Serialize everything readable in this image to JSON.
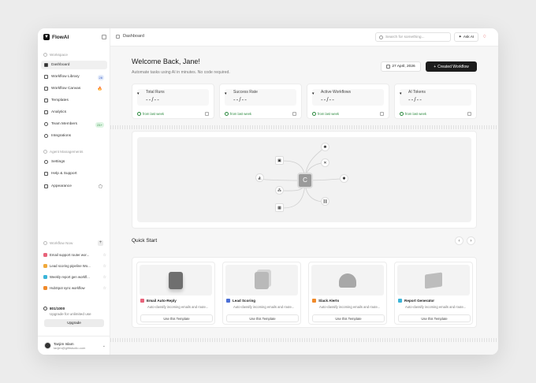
{
  "app": {
    "name": "FlowAI"
  },
  "topbar": {
    "breadcrumb": "Dashboard",
    "search_placeholder": "Search for something...",
    "ask_ai": "Ask AI"
  },
  "sidebar": {
    "workspace_label": "Workspace",
    "nav": [
      {
        "label": "Dashboard",
        "icon": "grid-icon"
      },
      {
        "label": "Workflow Library",
        "icon": "library-icon",
        "badge": "28"
      },
      {
        "label": "Workflow Canvas",
        "icon": "canvas-icon",
        "badge": "🔥"
      },
      {
        "label": "Templates",
        "icon": "templates-icon"
      },
      {
        "label": "Analytics",
        "icon": "analytics-icon"
      },
      {
        "label": "Team Members",
        "icon": "team-icon",
        "badge": "21+"
      },
      {
        "label": "Integrations",
        "icon": "integrations-icon"
      }
    ],
    "agent_label": "Agent Managements",
    "agent_nav": [
      {
        "label": "Settings",
        "icon": "gear-icon"
      },
      {
        "label": "Help & Support",
        "icon": "help-icon"
      },
      {
        "label": "Appearance",
        "icon": "appearance-icon"
      }
    ],
    "workflow_now_label": "Workflow Now",
    "workflows": [
      {
        "label": "Email support router wor...",
        "color": "#e8637a"
      },
      {
        "label": "Lead scoring pipeline Wo...",
        "color": "#f0a93b"
      },
      {
        "label": "Weekly report gen workfl...",
        "color": "#3bb4d8"
      },
      {
        "label": "HubSpot sync workflow",
        "color": "#f08a2a"
      }
    ],
    "usage": "801/1000",
    "usage_note": "Upgrade for unlimited use",
    "upgrade": "Upgrade",
    "user": {
      "name": "Tanjim Islam",
      "email": "tanjim@gifitstudio.com"
    }
  },
  "header": {
    "title": "Welcome Back, Jane!",
    "subtitle": "Automate tasks using AI in minutes. No code required.",
    "date": "27 April, 2026",
    "create_label": "Created Workflow"
  },
  "stats": [
    {
      "label": "Total Runs",
      "value": "--/--",
      "footer": "from last week"
    },
    {
      "label": "Success Rate",
      "value": "--/--",
      "footer": "from last week"
    },
    {
      "label": "Active Workflows",
      "value": "--/--",
      "footer": "from last week"
    },
    {
      "label": "AI Tokens",
      "value": "--/--",
      "footer": "from last week"
    }
  ],
  "quick_start": {
    "title": "Quick Start",
    "cards": [
      {
        "title": "Email Auto-Reply",
        "desc": "Auto-classify incoming emails and route...",
        "button": "Use this Template",
        "color": "#e8637a"
      },
      {
        "title": "Lead Scoring",
        "desc": "Auto-classify incoming emails and route...",
        "button": "Use this Template",
        "color": "#4b6fd6"
      },
      {
        "title": "Slack Alerts",
        "desc": "Auto-classify incoming emails and route...",
        "button": "Use this Template",
        "color": "#f08a2a"
      },
      {
        "title": "Report Generator",
        "desc": "Auto-classify incoming emails and route...",
        "button": "Use this Template",
        "color": "#3bb4d8"
      }
    ]
  }
}
